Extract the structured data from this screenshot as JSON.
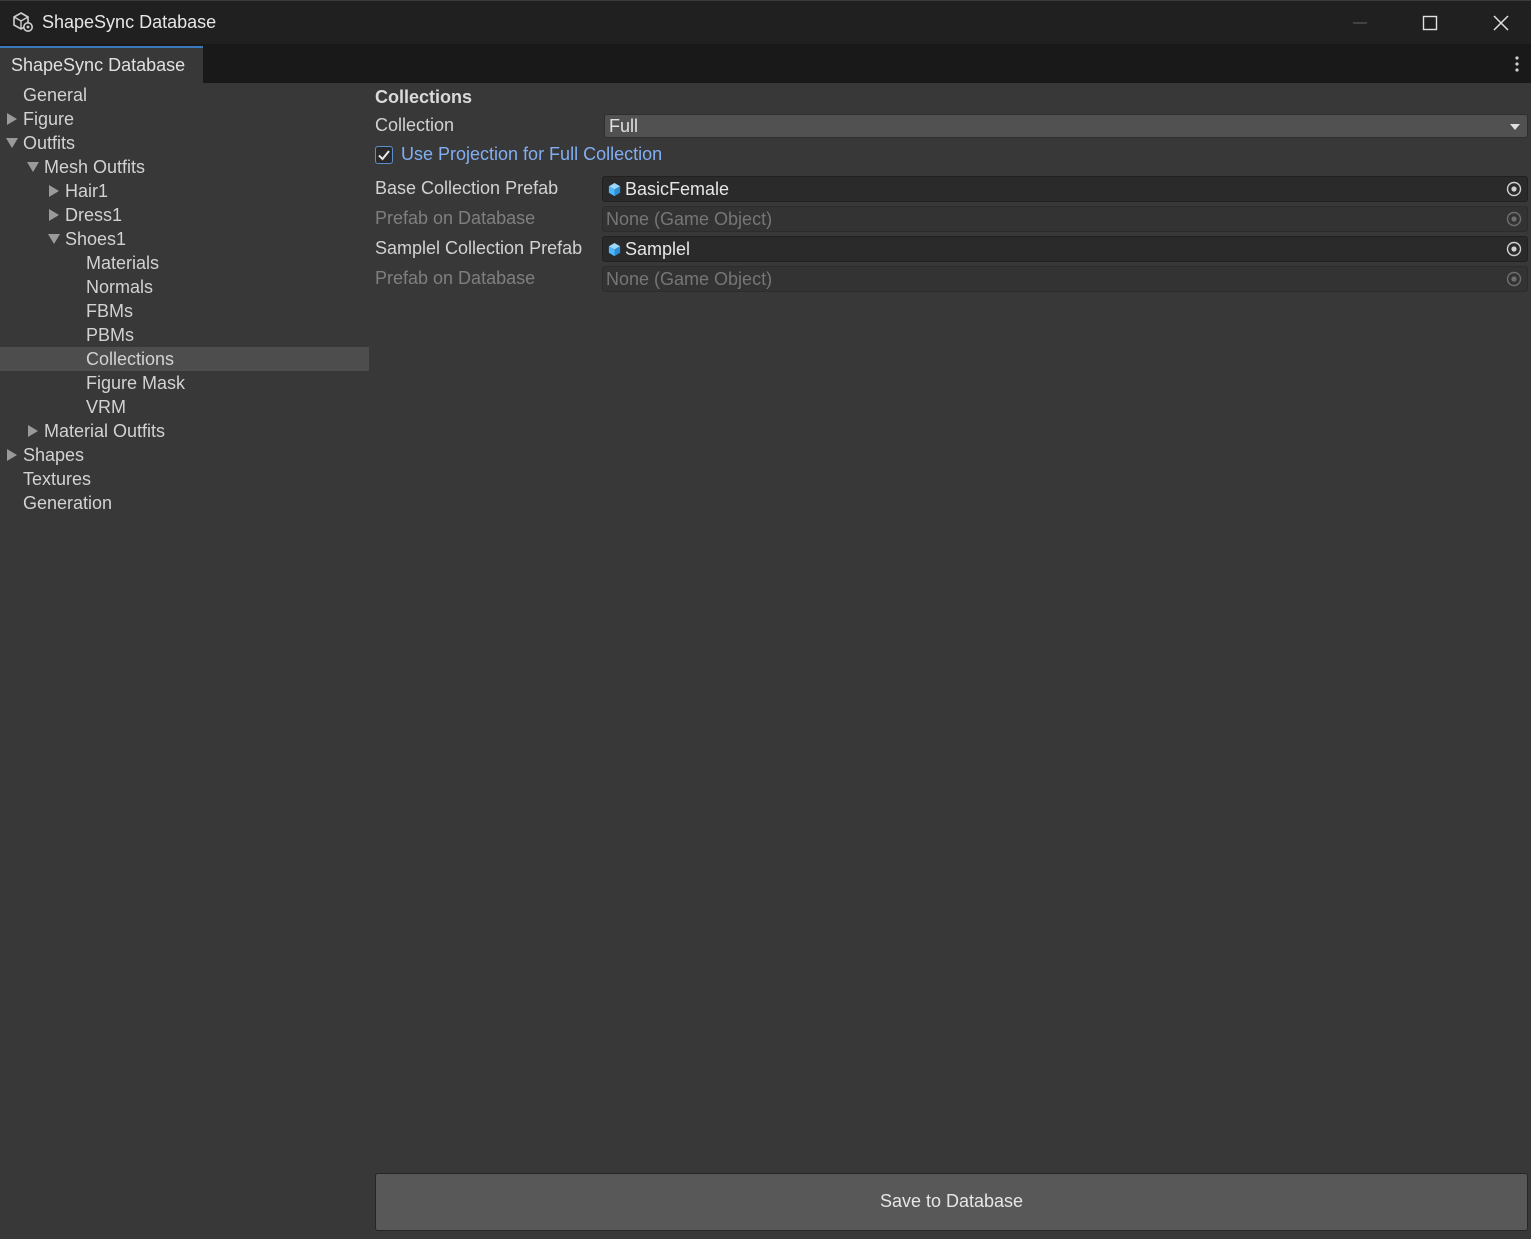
{
  "window": {
    "title": "ShapeSync Database",
    "app_icon": "unity-cube-cog-icon",
    "controls": [
      "minimize-icon",
      "maximize-icon",
      "close-icon"
    ]
  },
  "tabbar": {
    "active_tab": "ShapeSync Database",
    "menu_icon": "kebab-menu-icon"
  },
  "sidebar": {
    "items": [
      {
        "label": "General",
        "depth": 0,
        "arrow": "none"
      },
      {
        "label": "Figure",
        "depth": 0,
        "arrow": "collapsed"
      },
      {
        "label": "Outfits",
        "depth": 0,
        "arrow": "expanded"
      },
      {
        "label": "Mesh Outfits",
        "depth": 1,
        "arrow": "expanded"
      },
      {
        "label": "Hair1",
        "depth": 2,
        "arrow": "collapsed"
      },
      {
        "label": "Dress1",
        "depth": 2,
        "arrow": "collapsed"
      },
      {
        "label": "Shoes1",
        "depth": 2,
        "arrow": "expanded"
      },
      {
        "label": "Materials",
        "depth": 3,
        "arrow": "none"
      },
      {
        "label": "Normals",
        "depth": 3,
        "arrow": "none"
      },
      {
        "label": "FBMs",
        "depth": 3,
        "arrow": "none"
      },
      {
        "label": "PBMs",
        "depth": 3,
        "arrow": "none"
      },
      {
        "label": "Collections",
        "depth": 3,
        "arrow": "none",
        "selected": true
      },
      {
        "label": "Figure Mask",
        "depth": 3,
        "arrow": "none"
      },
      {
        "label": "VRM",
        "depth": 3,
        "arrow": "none"
      },
      {
        "label": "Material Outfits",
        "depth": 1,
        "arrow": "collapsed"
      },
      {
        "label": "Shapes",
        "depth": 0,
        "arrow": "collapsed"
      },
      {
        "label": "Textures",
        "depth": 0,
        "arrow": "none"
      },
      {
        "label": "Generation",
        "depth": 0,
        "arrow": "none"
      }
    ]
  },
  "main": {
    "section_title": "Collections",
    "collection": {
      "label": "Collection",
      "value": "Full"
    },
    "use_projection": {
      "label": "Use Projection for Full Collection",
      "checked": true
    },
    "base_prefab": {
      "label": "Base Collection Prefab",
      "value": "BasicFemale"
    },
    "base_db": {
      "label": "Prefab on Database",
      "value": "None (Game Object)"
    },
    "sample_prefab": {
      "label": "Samplel Collection Prefab",
      "value": "Samplel"
    },
    "sample_db": {
      "label": "Prefab on Database",
      "value": "None (Game Object)"
    },
    "save_button": "Save to Database"
  },
  "colors": {
    "accent": "#3a79bb",
    "check_label": "#82aef2",
    "prefab_icon": "#4db8ff"
  }
}
